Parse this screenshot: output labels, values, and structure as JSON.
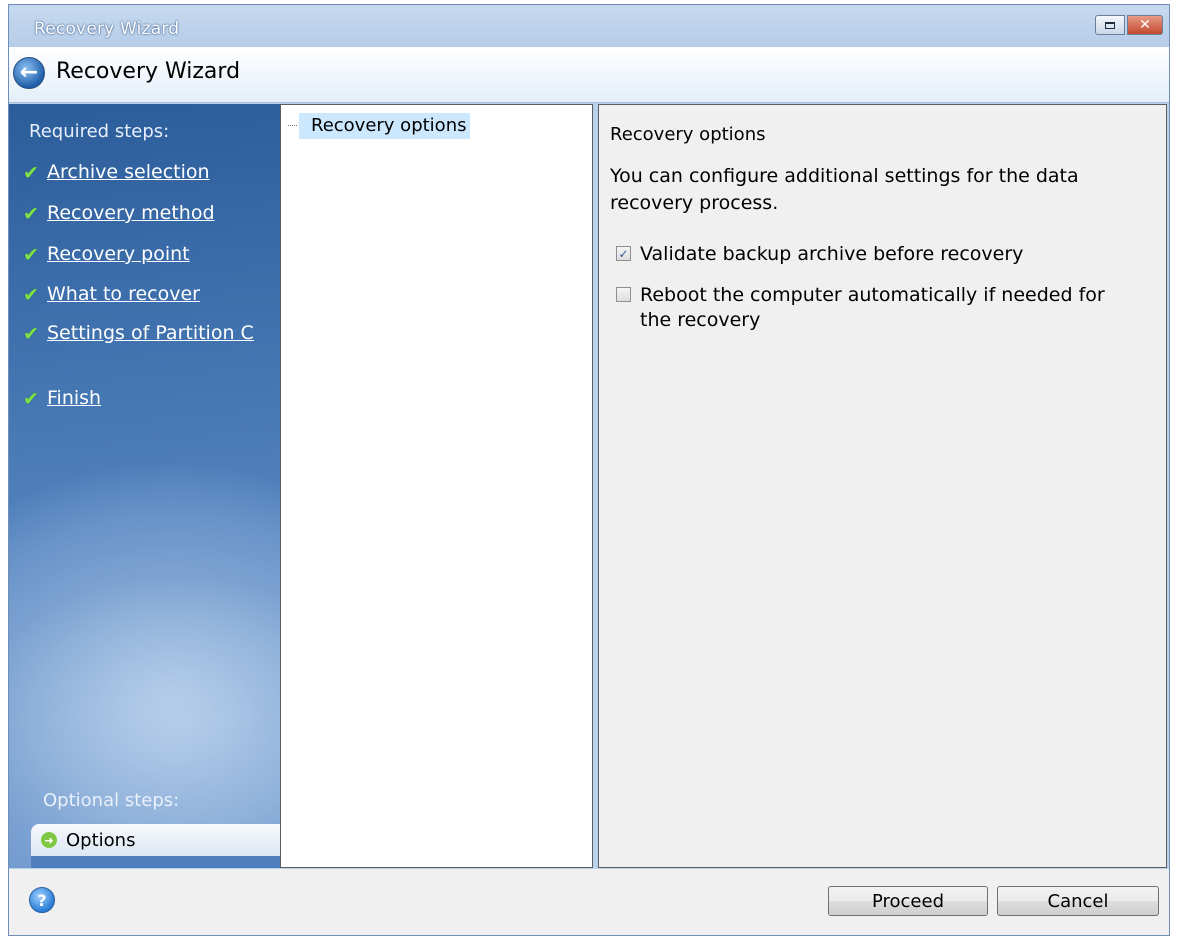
{
  "window": {
    "title": "Recovery Wizard",
    "close_glyph": "✕"
  },
  "header": {
    "title": "Recovery Wizard",
    "back_glyph": "←"
  },
  "steps": {
    "required_header": "Required steps:",
    "check_glyph": "✔",
    "items": [
      {
        "label": "Archive selection",
        "done": true
      },
      {
        "label": "Recovery method",
        "done": true
      },
      {
        "label": "Recovery point",
        "done": true
      },
      {
        "label": "What to recover",
        "done": true
      },
      {
        "label": "Settings of Partition C",
        "done": true
      },
      {
        "label": "Finish",
        "done": true
      }
    ],
    "optional_header": "Optional steps:",
    "optional_items": [
      {
        "label": "Options",
        "icon": "arrow-right-icon",
        "glyph": "➜"
      }
    ]
  },
  "tree": {
    "items": [
      {
        "label": "Recovery options",
        "selected": true
      }
    ]
  },
  "options": {
    "title": "Recovery options",
    "description": "You can configure additional settings for the data recovery process.",
    "checkboxes": [
      {
        "label": "Validate backup archive before recovery",
        "checked": true,
        "check_glyph": "✓"
      },
      {
        "label": "Reboot the computer automatically if needed for the recovery",
        "checked": false,
        "check_glyph": ""
      }
    ]
  },
  "footer": {
    "help_glyph": "?",
    "proceed_label": "Proceed",
    "cancel_label": "Cancel"
  },
  "colors": {
    "steps_panel": "#3f70ae",
    "check": "#7ee24a",
    "tree_selection": "#cce8ff"
  }
}
